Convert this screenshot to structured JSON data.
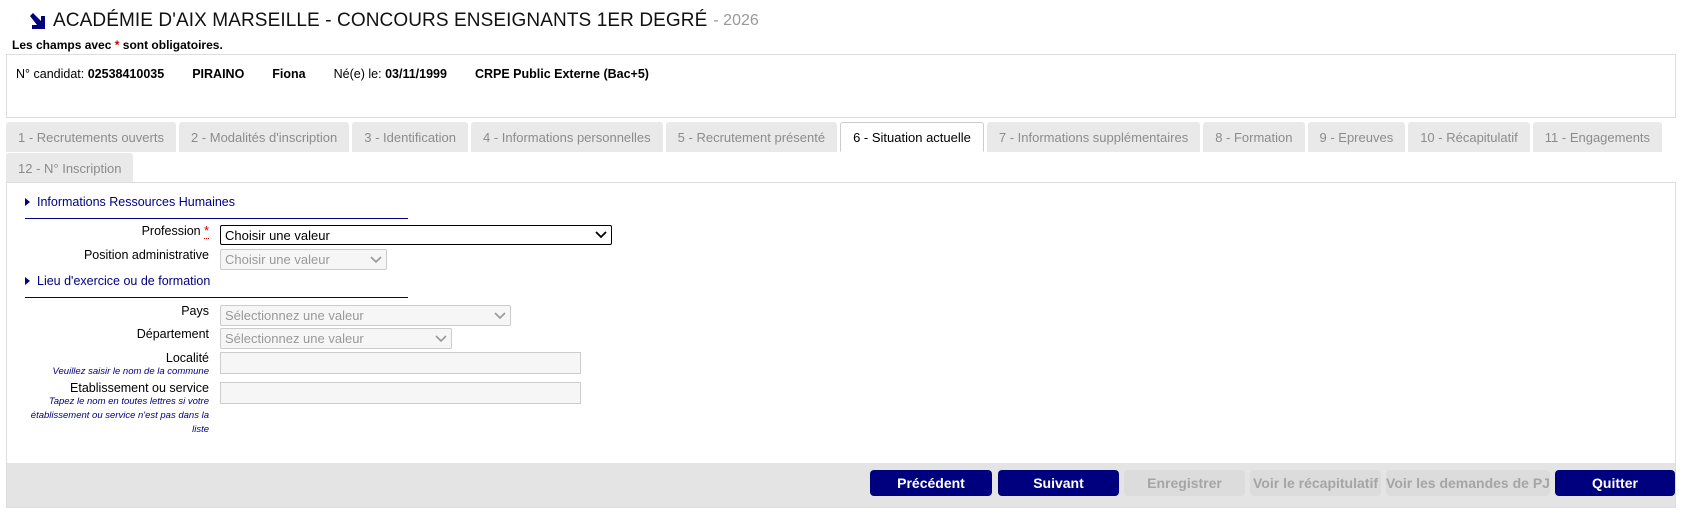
{
  "header": {
    "title": "ACADÉMIE D'AIX MARSEILLE - CONCOURS ENSEIGNANTS 1ER DEGRÉ",
    "year": "- 2026",
    "arrow_icon": "arrow-down-right-icon"
  },
  "mandatory_note": {
    "prefix": "Les champs avec",
    "star": "*",
    "suffix": "sont obligatoires."
  },
  "candidate": {
    "number_label": "N° candidat:",
    "number": "02538410035",
    "last_name": "PIRAINO",
    "first_name": "Fiona",
    "birth_label": "Né(e) le:",
    "birth_date": "03/11/1999",
    "competition": "CRPE Public Externe (Bac+5)"
  },
  "tabs_row1": [
    {
      "label": "1 - Recrutements ouverts"
    },
    {
      "label": "2 - Modalités d'inscription"
    },
    {
      "label": "3 - Identification"
    },
    {
      "label": "4 - Informations personnelles"
    },
    {
      "label": "5 - Recrutement présenté"
    },
    {
      "label": "6 - Situation actuelle"
    },
    {
      "label": "7 - Informations supplémentaires"
    },
    {
      "label": "8 - Formation"
    },
    {
      "label": "9 - Epreuves"
    },
    {
      "label": "10 - Récapitulatif"
    },
    {
      "label": "11 - Engagements"
    }
  ],
  "tabs_row2": [
    {
      "label": "12 - N° Inscription"
    }
  ],
  "active_tab": "6 - Situation actuelle",
  "section_rh": {
    "title": "Informations Ressources Humaines",
    "profession_label": "Profession",
    "required_star": "*",
    "profession_value": "Choisir une valeur",
    "position_label": "Position administrative",
    "position_value": "Choisir une valeur"
  },
  "section_lieu": {
    "title": "Lieu d'exercice ou de formation",
    "pays_label": "Pays",
    "pays_value": "Sélectionnez une valeur",
    "departement_label": "Département",
    "departement_value": "Sélectionnez une valeur",
    "localite_label": "Localité",
    "localite_hint": "Veuillez saisir le nom de la commune",
    "etab_label": "Etablissement ou service",
    "etab_hint_1": "Tapez le nom en toutes lettres si votre",
    "etab_hint_2": "établissement ou service n'est pas dans la",
    "etab_hint_3": "liste"
  },
  "buttons": {
    "prev": "Précédent",
    "next": "Suivant",
    "save": "Enregistrer",
    "recap": "Voir le récapitulatif",
    "pj": "Voir les demandes de PJ",
    "quit": "Quitter"
  },
  "colors": {
    "primary": "#00007f",
    "required": "#cc0000",
    "tab_inactive_bg": "#e9e9e9",
    "footer_bg": "#e4e4e4"
  }
}
